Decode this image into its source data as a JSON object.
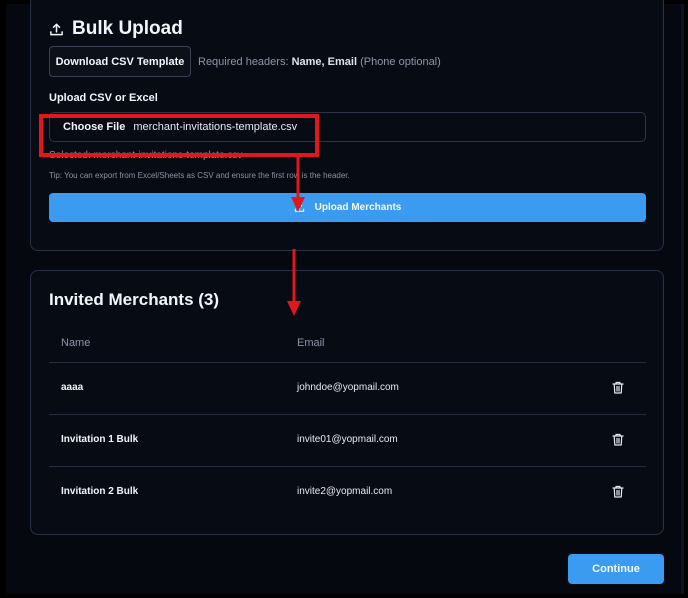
{
  "bulk_upload": {
    "title": "Bulk Upload",
    "download_button": "Download CSV Template",
    "required_prefix": "Required headers: ",
    "required_name": "Name",
    "required_sep": ", ",
    "required_email": "Email",
    "required_suffix": " (Phone optional)",
    "upload_label": "Upload CSV or Excel",
    "choose_file_label": "Choose File",
    "file_name": "merchant-invitations-template.csv",
    "selected_text": "Selected: merchant-invitations-template.csv",
    "tip_text": "Tip: You can export from Excel/Sheets as CSV and ensure the first row is the header.",
    "upload_button": "Upload Merchants"
  },
  "invited": {
    "title": "Invited Merchants (3)",
    "columns": [
      "Name",
      "Email"
    ],
    "rows": [
      {
        "name": "aaaa",
        "email": "johndoe@yopmail.com"
      },
      {
        "name": "Invitation 1 Bulk",
        "email": "invite01@yopmail.com"
      },
      {
        "name": "Invitation 2 Bulk",
        "email": "invite2@yopmail.com"
      }
    ]
  },
  "footer": {
    "continue_button": "Continue"
  },
  "colors": {
    "accent": "#3b9bf0",
    "annotation_red": "#e0171d",
    "background": "#05080f"
  },
  "icons": [
    "upload-icon",
    "trash-icon"
  ]
}
